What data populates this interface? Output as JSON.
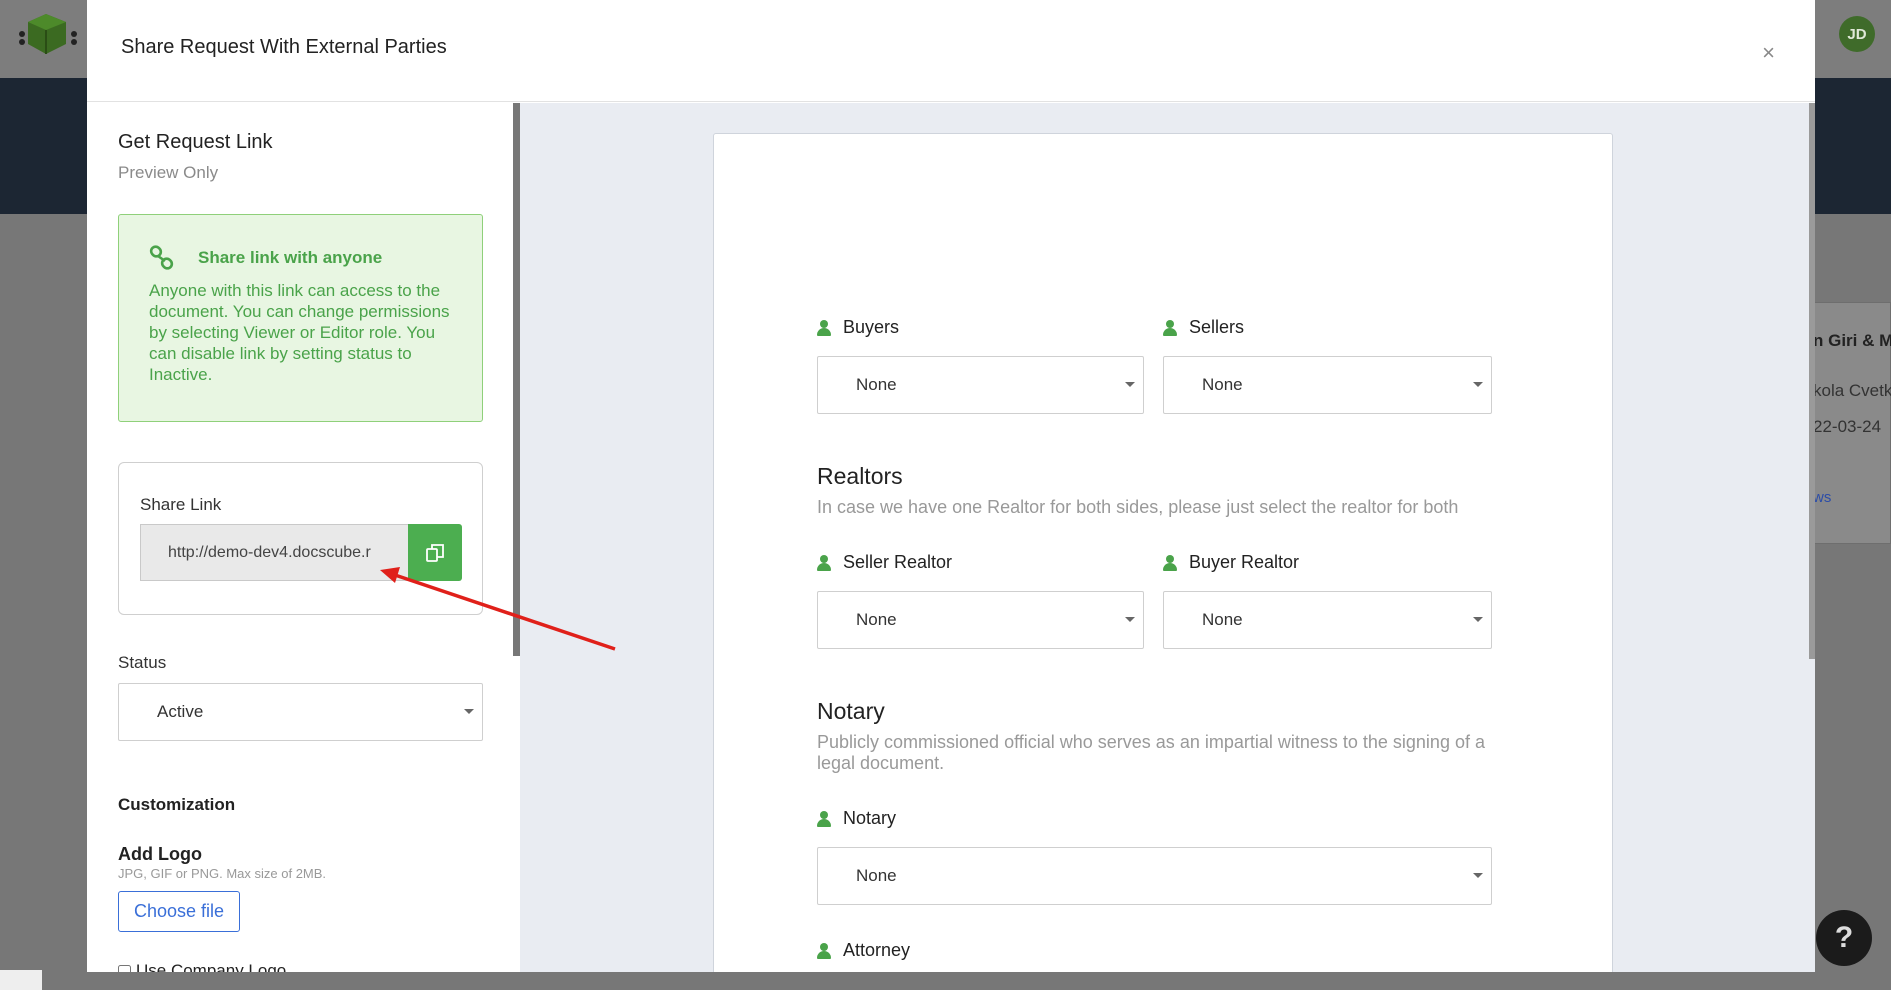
{
  "background": {
    "avatar_initials": "JD",
    "card_lines": [
      "n Giri & M",
      "kola Cvetk",
      "22-03-24",
      "ws"
    ],
    "help_label": "?"
  },
  "modal": {
    "title": "Share Request With External Parties",
    "close": "×"
  },
  "left": {
    "title": "Get Request Link",
    "subtitle": "Preview Only",
    "info_heading": "Share link with anyone",
    "info_text": "Anyone with this link can access to the document. You can change permissions by selecting Viewer or Editor role. You can disable link by setting status to Inactive.",
    "share_label": "Share Link",
    "share_value": "http://demo-dev4.docscube.r",
    "status_label": "Status",
    "status_value": "Active",
    "customization_title": "Customization",
    "add_logo_title": "Add Logo",
    "add_logo_hint": "JPG, GIF or PNG. Max size of 2MB.",
    "choose_file": "Choose file",
    "use_company_logo": "Use Company Logo"
  },
  "document": {
    "buyers_label": "Buyers",
    "buyers_value": "None",
    "sellers_label": "Sellers",
    "sellers_value": "None",
    "realtors_title": "Realtors",
    "realtors_desc": "In case we have one Realtor for both sides, please just select the realtor for both",
    "seller_realtor_label": "Seller Realtor",
    "seller_realtor_value": "None",
    "buyer_realtor_label": "Buyer Realtor",
    "buyer_realtor_value": "None",
    "notary_title": "Notary",
    "notary_desc": "Publicly commissioned official who serves as an impartial witness to the signing of a legal document.",
    "notary_label": "Notary",
    "notary_value": "None",
    "attorney_label": "Attorney"
  },
  "colors": {
    "accent_green": "#4cae50",
    "info_bg": "#e8f6e2",
    "link_blue": "#3a6fd8",
    "annotation_red": "#e0201a"
  }
}
